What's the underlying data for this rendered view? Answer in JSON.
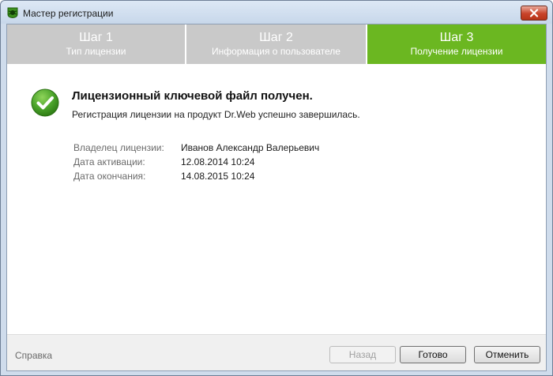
{
  "window": {
    "title": "Мастер регистрации"
  },
  "steps": [
    {
      "title": "Шаг 1",
      "subtitle": "Тип лицензии",
      "active": false
    },
    {
      "title": "Шаг 2",
      "subtitle": "Информация о пользователе",
      "active": false
    },
    {
      "title": "Шаг 3",
      "subtitle": "Получение лицензии",
      "active": true
    }
  ],
  "content": {
    "headline": "Лицензионный ключевой файл получен.",
    "message": "Регистрация лицензии на продукт Dr.Web успешно завершилась.",
    "details": [
      {
        "label": "Владелец лицензии:",
        "value": "Иванов Александр Валерьевич"
      },
      {
        "label": "Дата активации:",
        "value": "12.08.2014 10:24"
      },
      {
        "label": "Дата окончания:",
        "value": "14.08.2015 10:24"
      }
    ]
  },
  "footer": {
    "help_label": "Справка",
    "back_label": "Назад",
    "done_label": "Готово",
    "cancel_label": "Отменить"
  },
  "colors": {
    "active_step": "#6bb721",
    "inactive_step": "#c9c9c9",
    "success_check": "#4aa32a"
  }
}
